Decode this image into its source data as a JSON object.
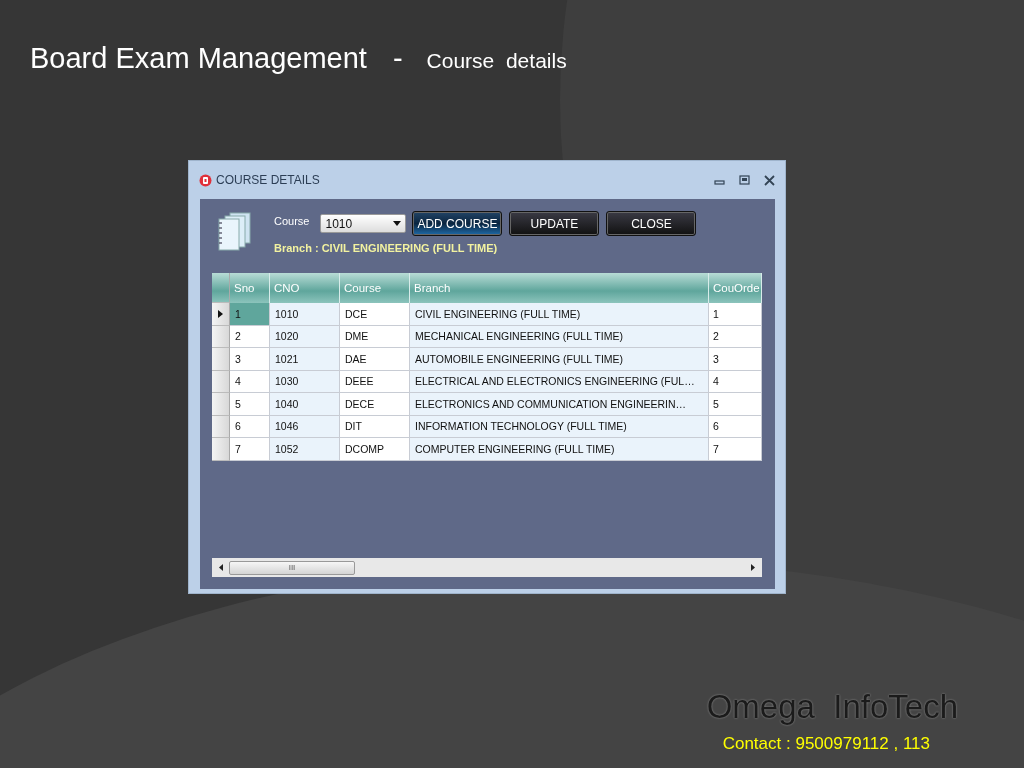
{
  "slide": {
    "title": "Board Exam Management",
    "separator": "-",
    "subtitle": "Course  details"
  },
  "window": {
    "title": "COURSE DETAILS",
    "course_field": {
      "label": "Course",
      "value": "1010"
    },
    "buttons": [
      {
        "label": "ADD COURSE",
        "focused": true
      },
      {
        "label": "UPDATE",
        "focused": false
      },
      {
        "label": "CLOSE",
        "focused": false
      }
    ],
    "branch_line": "Branch : CIVIL ENGINEERING (FULL TIME)",
    "table": {
      "columns": [
        "Sno",
        "CNO",
        "Course",
        "Branch",
        "CouOrde"
      ],
      "rows": [
        {
          "cells": [
            "1",
            "1010",
            "DCE",
            "CIVIL ENGINEERING (FULL TIME)",
            "1"
          ],
          "selected": true
        },
        {
          "cells": [
            "2",
            "1020",
            "DME",
            "MECHANICAL ENGINEERING (FULL TIME)",
            "2"
          ],
          "selected": false
        },
        {
          "cells": [
            "3",
            "1021",
            "DAE",
            "AUTOMOBILE ENGINEERING (FULL TIME)",
            "3"
          ],
          "selected": false
        },
        {
          "cells": [
            "4",
            "1030",
            "DEEE",
            "ELECTRICAL AND ELECTRONICS ENGINEERING (FUL…",
            "4"
          ],
          "selected": false
        },
        {
          "cells": [
            "5",
            "1040",
            "DECE",
            "ELECTRONICS AND COMMUNICATION ENGINEERIN…",
            "5"
          ],
          "selected": false
        },
        {
          "cells": [
            "6",
            "1046",
            "DIT",
            "INFORMATION TECHNOLOGY (FULL TIME)",
            "6"
          ],
          "selected": false
        },
        {
          "cells": [
            "7",
            "1052",
            "DCOMP",
            "COMPUTER ENGINEERING (FULL TIME)",
            "7"
          ],
          "selected": false
        }
      ]
    },
    "scrollbar_grip": "III"
  },
  "footer": {
    "company": "Omega  InfoTech",
    "contact": "Contact : 9500979112 , 113"
  }
}
